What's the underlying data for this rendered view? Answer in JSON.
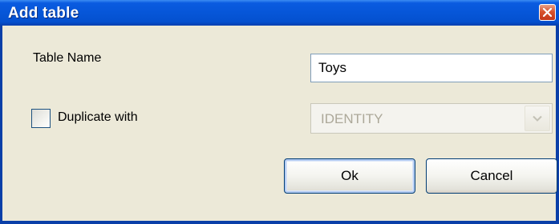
{
  "window": {
    "title": "Add table"
  },
  "form": {
    "table_name_label": "Table Name",
    "table_name_value": "Toys",
    "duplicate_label": "Duplicate with",
    "duplicate_checked": false,
    "duplicate_select_value": "IDENTITY"
  },
  "buttons": {
    "ok_label": "Ok",
    "cancel_label": "Cancel"
  },
  "icons": {
    "close": "close-icon",
    "dropdown": "chevron-down-icon"
  },
  "colors": {
    "titlebar": "#0656D8",
    "window_bg": "#ECE9D8",
    "close_button": "#D8532C",
    "disabled_text": "#ACA899"
  }
}
